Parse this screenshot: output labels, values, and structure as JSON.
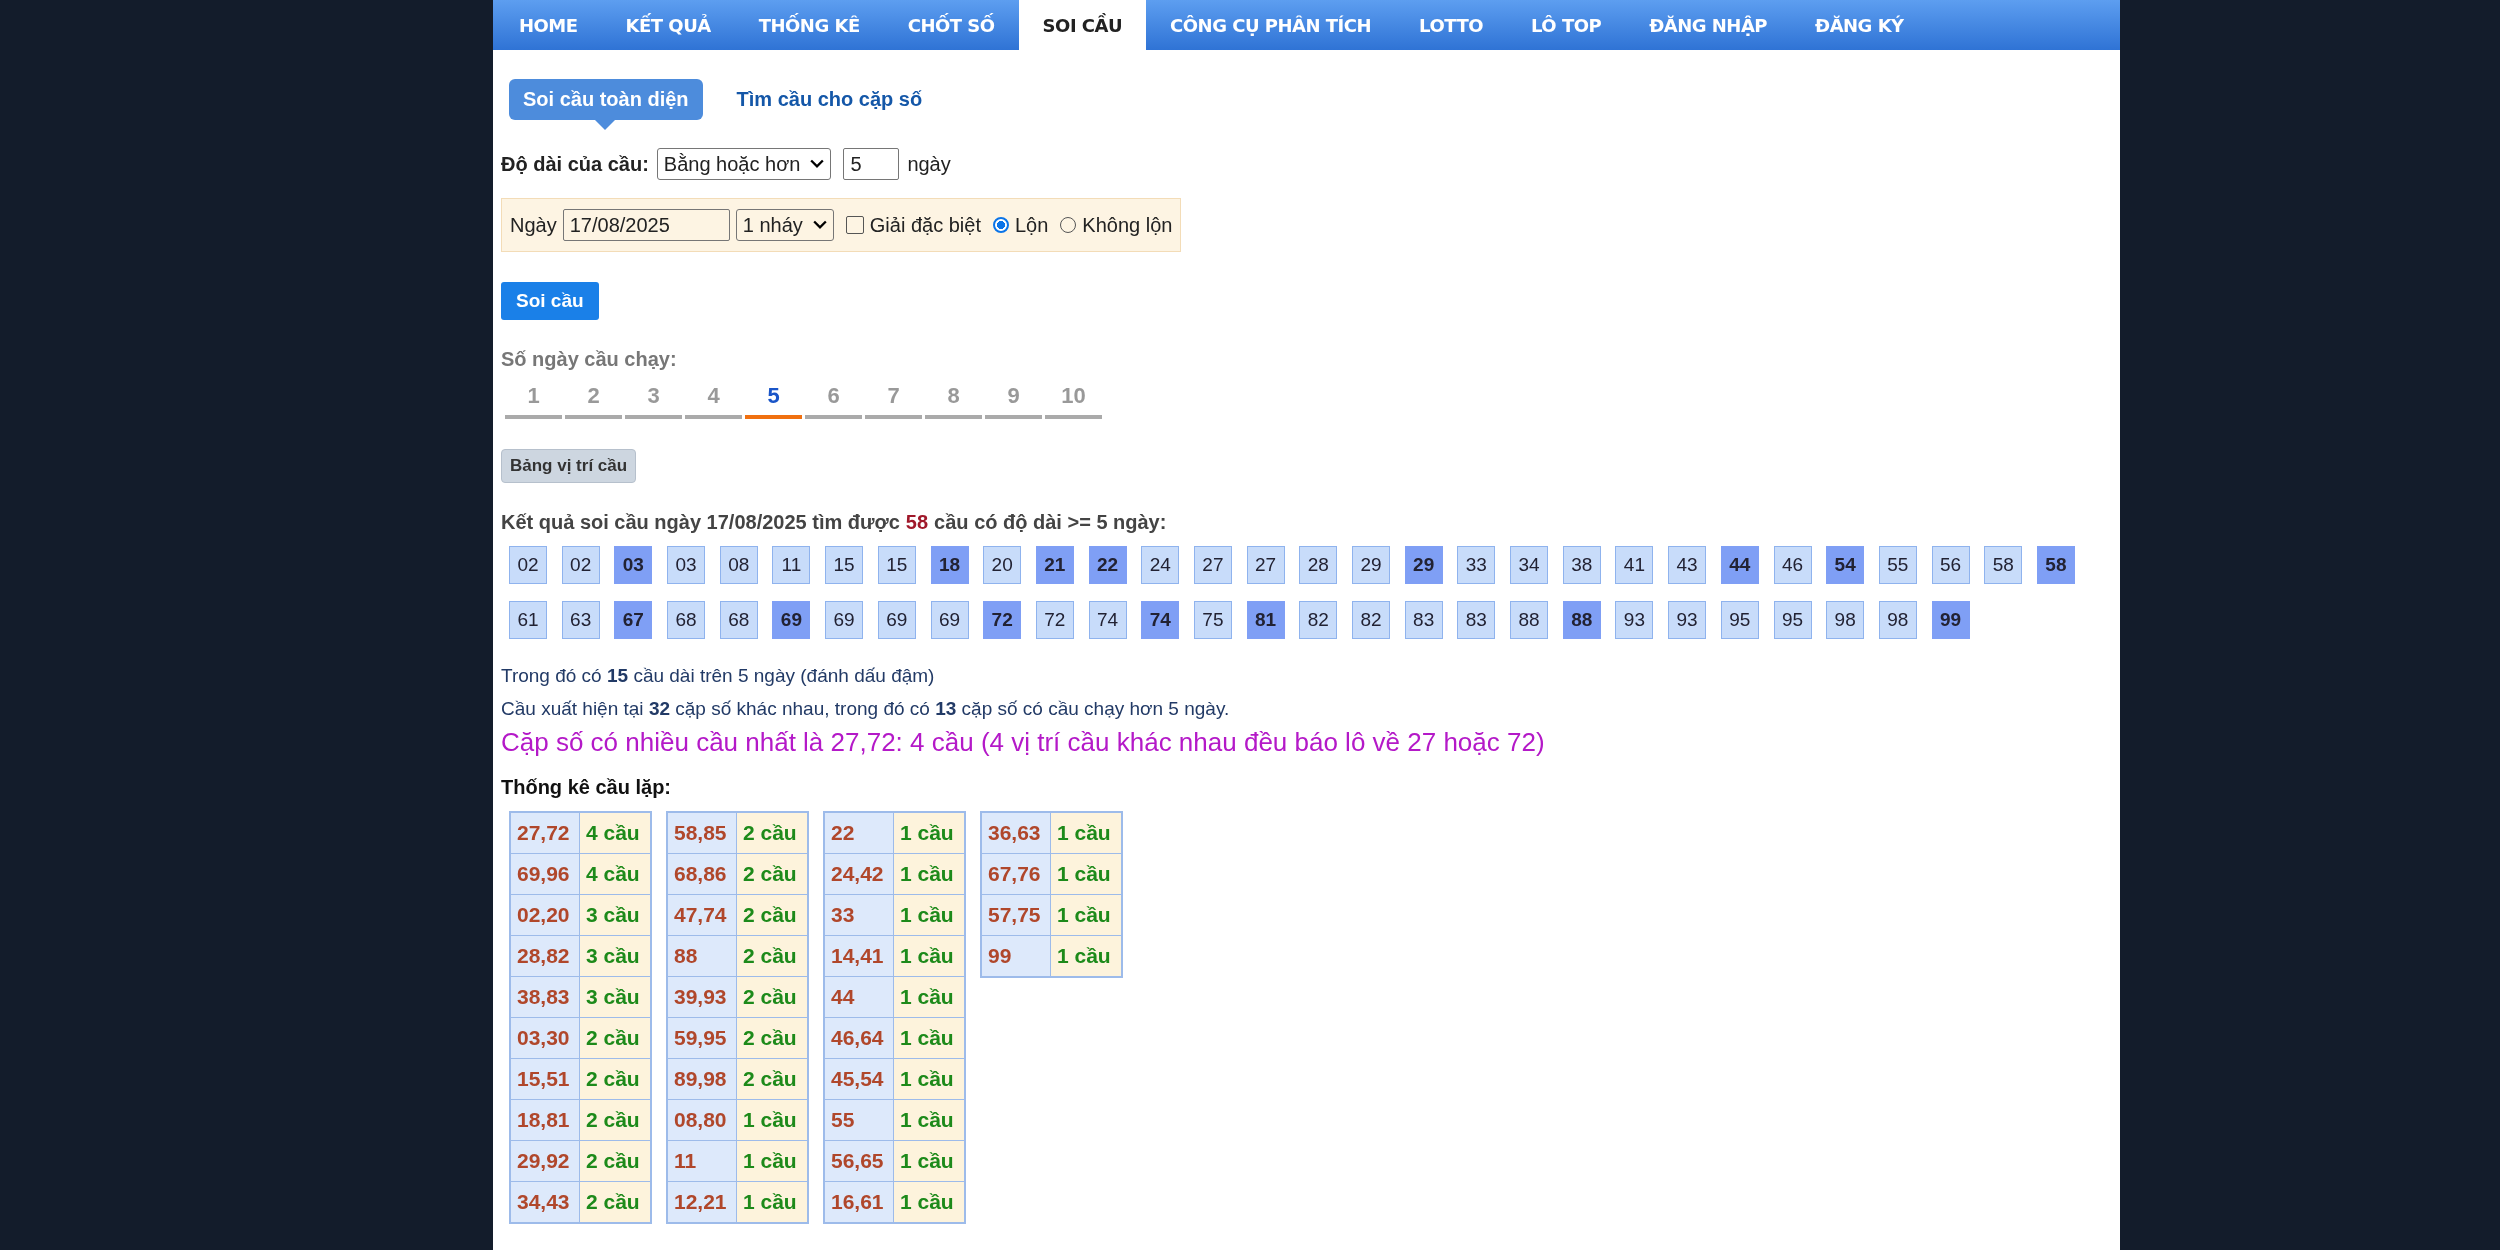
{
  "nav": [
    {
      "label": "HOME",
      "selected": false
    },
    {
      "label": "KẾT QUẢ",
      "selected": false
    },
    {
      "label": "THỐNG KÊ",
      "selected": false
    },
    {
      "label": "CHỐT SỐ",
      "selected": false
    },
    {
      "label": "SOI CẦU",
      "selected": true
    },
    {
      "label": "CÔNG CỤ PHÂN TÍCH",
      "selected": false
    },
    {
      "label": "LOTTO",
      "selected": false
    },
    {
      "label": "LÔ TOP",
      "selected": false
    },
    {
      "label": "ĐĂNG NHẬP",
      "selected": false
    },
    {
      "label": "ĐĂNG KÝ",
      "selected": false
    }
  ],
  "subtabs": [
    {
      "label": "Soi cầu toàn diện",
      "selected": true
    },
    {
      "label": "Tìm cầu cho cặp số",
      "selected": false
    }
  ],
  "length_filter": {
    "label": "Độ dài của cầu:",
    "select_value": "Bằng hoặc hơn",
    "days_value": "5",
    "unit": "ngày"
  },
  "options": {
    "date_label": "Ngày",
    "date_value": "17/08/2025",
    "mode_value": "1 nháy",
    "special": {
      "label": "Giải đặc biệt",
      "checked": false
    },
    "radios": [
      {
        "label": "Lộn",
        "selected": true
      },
      {
        "label": "Không lộn",
        "selected": false
      }
    ]
  },
  "submit_button": "Soi cầu",
  "run_days": {
    "label": "Số ngày cầu chạy:",
    "items": [
      {
        "label": "1",
        "selected": false
      },
      {
        "label": "2",
        "selected": false
      },
      {
        "label": "3",
        "selected": false
      },
      {
        "label": "4",
        "selected": false
      },
      {
        "label": "5",
        "selected": true
      },
      {
        "label": "6",
        "selected": false
      },
      {
        "label": "7",
        "selected": false
      },
      {
        "label": "8",
        "selected": false
      },
      {
        "label": "9",
        "selected": false
      },
      {
        "label": "10",
        "selected": false
      }
    ]
  },
  "position_button": "Bảng vị trí cầu",
  "result_heading": {
    "before": "Kết quả soi cầu ngày 17/08/2025 tìm được",
    "count": "58",
    "after": "cầu có độ dài >= 5 ngày:"
  },
  "numbers": [
    {
      "value": "02",
      "highlighted": false
    },
    {
      "value": "02",
      "highlighted": false
    },
    {
      "value": "03",
      "highlighted": true
    },
    {
      "value": "03",
      "highlighted": false
    },
    {
      "value": "08",
      "highlighted": false
    },
    {
      "value": "11",
      "highlighted": false
    },
    {
      "value": "15",
      "highlighted": false
    },
    {
      "value": "15",
      "highlighted": false
    },
    {
      "value": "18",
      "highlighted": true
    },
    {
      "value": "20",
      "highlighted": false
    },
    {
      "value": "21",
      "highlighted": true
    },
    {
      "value": "22",
      "highlighted": true
    },
    {
      "value": "24",
      "highlighted": false
    },
    {
      "value": "27",
      "highlighted": false
    },
    {
      "value": "27",
      "highlighted": false
    },
    {
      "value": "28",
      "highlighted": false
    },
    {
      "value": "29",
      "highlighted": false
    },
    {
      "value": "29",
      "highlighted": true
    },
    {
      "value": "33",
      "highlighted": false
    },
    {
      "value": "34",
      "highlighted": false
    },
    {
      "value": "38",
      "highlighted": false
    },
    {
      "value": "41",
      "highlighted": false
    },
    {
      "value": "43",
      "highlighted": false
    },
    {
      "value": "44",
      "highlighted": true
    },
    {
      "value": "46",
      "highlighted": false
    },
    {
      "value": "54",
      "highlighted": true
    },
    {
      "value": "55",
      "highlighted": false
    },
    {
      "value": "56",
      "highlighted": false
    },
    {
      "value": "58",
      "highlighted": false
    },
    {
      "value": "58",
      "highlighted": true
    },
    {
      "value": "61",
      "highlighted": false
    },
    {
      "value": "63",
      "highlighted": false
    },
    {
      "value": "67",
      "highlighted": true
    },
    {
      "value": "68",
      "highlighted": false
    },
    {
      "value": "68",
      "highlighted": false
    },
    {
      "value": "69",
      "highlighted": true
    },
    {
      "value": "69",
      "highlighted": false
    },
    {
      "value": "69",
      "highlighted": false
    },
    {
      "value": "69",
      "highlighted": false
    },
    {
      "value": "72",
      "highlighted": true
    },
    {
      "value": "72",
      "highlighted": false
    },
    {
      "value": "74",
      "highlighted": false
    },
    {
      "value": "74",
      "highlighted": true
    },
    {
      "value": "75",
      "highlighted": false
    },
    {
      "value": "81",
      "highlighted": true
    },
    {
      "value": "82",
      "highlighted": false
    },
    {
      "value": "82",
      "highlighted": false
    },
    {
      "value": "83",
      "highlighted": false
    },
    {
      "value": "83",
      "highlighted": false
    },
    {
      "value": "88",
      "highlighted": false
    },
    {
      "value": "88",
      "highlighted": true
    },
    {
      "value": "93",
      "highlighted": false
    },
    {
      "value": "93",
      "highlighted": false
    },
    {
      "value": "95",
      "highlighted": false
    },
    {
      "value": "95",
      "highlighted": false
    },
    {
      "value": "98",
      "highlighted": false
    },
    {
      "value": "98",
      "highlighted": false
    },
    {
      "value": "99",
      "highlighted": true
    }
  ],
  "summary_lines": [
    "Trong đó có **15** cầu dài trên 5 ngày (đánh dấu đậm)",
    "Cầu xuất hiện tại **32** cặp số khác nhau, trong đó có **13** cặp số có cầu chạy hơn 5 ngày."
  ],
  "highlight_line": "Cặp số có nhiều cầu nhất là 27,72: 4 cầu (4 vị trí cầu khác nhau đều báo lô về 27 hoặc 72)",
  "stats": {
    "title": "Thống kê cầu lặp:",
    "tables": [
      [
        {
          "pair": "27,72",
          "count": "4 cầu"
        },
        {
          "pair": "69,96",
          "count": "4 cầu"
        },
        {
          "pair": "02,20",
          "count": "3 cầu"
        },
        {
          "pair": "28,82",
          "count": "3 cầu"
        },
        {
          "pair": "38,83",
          "count": "3 cầu"
        },
        {
          "pair": "03,30",
          "count": "2 cầu"
        },
        {
          "pair": "15,51",
          "count": "2 cầu"
        },
        {
          "pair": "18,81",
          "count": "2 cầu"
        },
        {
          "pair": "29,92",
          "count": "2 cầu"
        },
        {
          "pair": "34,43",
          "count": "2 cầu"
        }
      ],
      [
        {
          "pair": "58,85",
          "count": "2 cầu"
        },
        {
          "pair": "68,86",
          "count": "2 cầu"
        },
        {
          "pair": "47,74",
          "count": "2 cầu"
        },
        {
          "pair": "88",
          "count": "2 cầu"
        },
        {
          "pair": "39,93",
          "count": "2 cầu"
        },
        {
          "pair": "59,95",
          "count": "2 cầu"
        },
        {
          "pair": "89,98",
          "count": "2 cầu"
        },
        {
          "pair": "08,80",
          "count": "1 cầu"
        },
        {
          "pair": "11",
          "count": "1 cầu"
        },
        {
          "pair": "12,21",
          "count": "1 cầu"
        }
      ],
      [
        {
          "pair": "22",
          "count": "1 cầu"
        },
        {
          "pair": "24,42",
          "count": "1 cầu"
        },
        {
          "pair": "33",
          "count": "1 cầu"
        },
        {
          "pair": "14,41",
          "count": "1 cầu"
        },
        {
          "pair": "44",
          "count": "1 cầu"
        },
        {
          "pair": "46,64",
          "count": "1 cầu"
        },
        {
          "pair": "45,54",
          "count": "1 cầu"
        },
        {
          "pair": "55",
          "count": "1 cầu"
        },
        {
          "pair": "56,65",
          "count": "1 cầu"
        },
        {
          "pair": "16,61",
          "count": "1 cầu"
        }
      ],
      [
        {
          "pair": "36,63",
          "count": "1 cầu"
        },
        {
          "pair": "67,76",
          "count": "1 cầu"
        },
        {
          "pair": "57,75",
          "count": "1 cầu"
        },
        {
          "pair": "99",
          "count": "1 cầu"
        }
      ]
    ]
  }
}
